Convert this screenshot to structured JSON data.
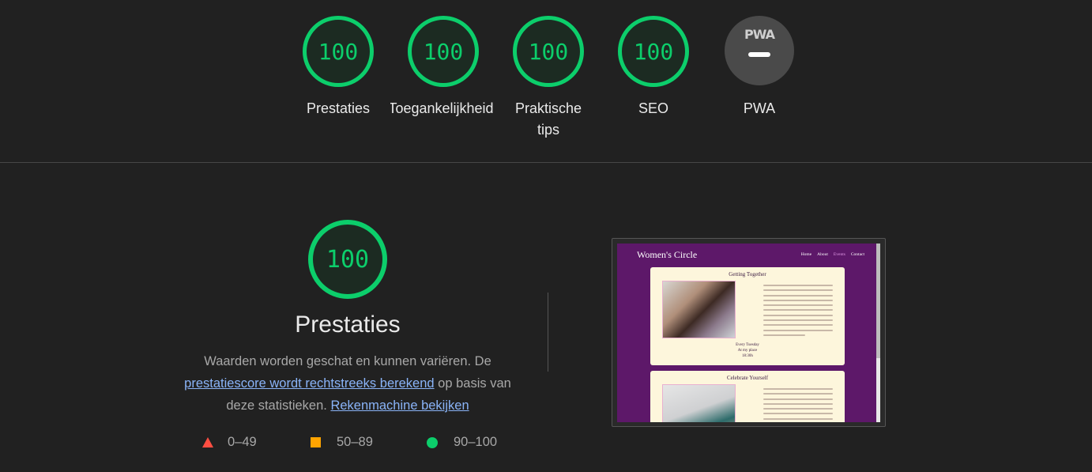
{
  "summary": {
    "gauges": [
      {
        "score": "100",
        "label": "Prestaties"
      },
      {
        "score": "100",
        "label": "Toegankelijkheid"
      },
      {
        "score": "100",
        "label": "Praktische tips"
      },
      {
        "score": "100",
        "label": "SEO"
      }
    ],
    "pwa": {
      "badge": "PWA",
      "label": "PWA"
    }
  },
  "performance": {
    "score": "100",
    "title": "Prestaties",
    "desc_part1": "Waarden worden geschat en kunnen variëren. De ",
    "link_score": "prestatiescore wordt rechtstreeks berekend",
    "desc_part2": " op basis van deze statistieken. ",
    "link_calc": "Rekenmachine bekijken",
    "legend": [
      {
        "shape": "triangle",
        "color": "#ff4e42",
        "range": "0–49"
      },
      {
        "shape": "square",
        "color": "#ffa400",
        "range": "50–89"
      },
      {
        "shape": "circle",
        "color": "#0cce6b",
        "range": "90–100"
      }
    ]
  },
  "screenshot": {
    "site_title": "Women's Circle",
    "nav": [
      "Home",
      "About",
      "Events",
      "Contact"
    ],
    "card1": {
      "title": "Getting Together",
      "line1": "Every Tuesday",
      "line2": "At my place",
      "line3": "18:30h"
    },
    "card2": {
      "title": "Celebrate Yourself"
    }
  },
  "colors": {
    "background": "#212121",
    "pass_green": "#0cce6b",
    "link_blue": "#8ab4f8",
    "site_purple": "#5d1869"
  }
}
